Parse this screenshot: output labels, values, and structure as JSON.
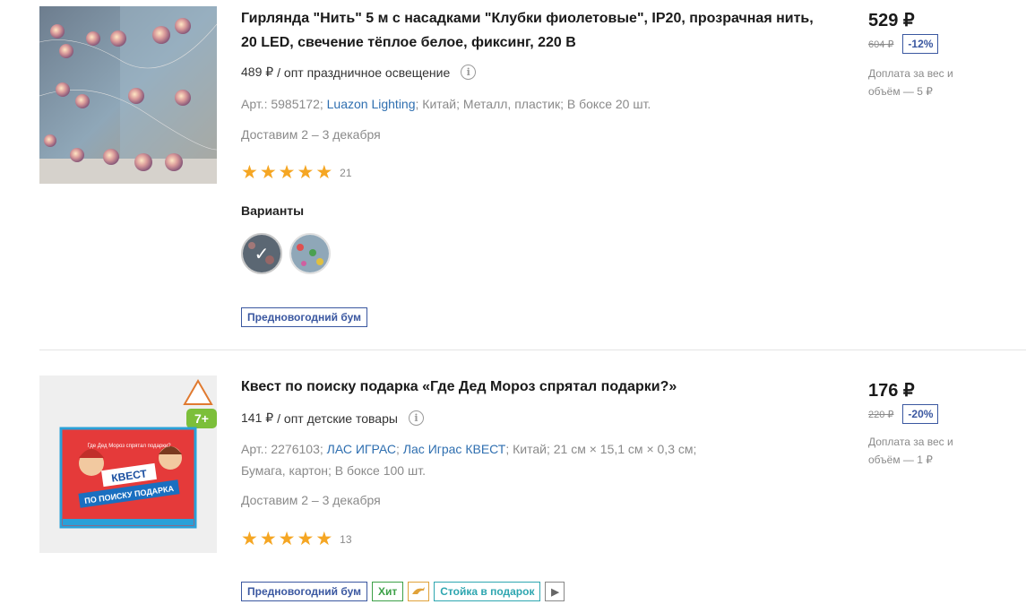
{
  "products": [
    {
      "title": "Гирлянда \"Нить\" 5 м с насадками \"Клубки фиолетовые\", IP20, прозрачная нить, 20 LED, свечение тёплое белое, фиксинг, 220 В",
      "opt_price": "489 ₽",
      "opt_label": "/ опт праздничное освещение",
      "art": "Арт.: 5985172;",
      "brand": "Luazon Lighting",
      "attrs": ";  Китай;  Металл, пластик;  В боксе 20 шт.",
      "delivery": "Доставим 2 – 3 декабря",
      "rating_count": "21",
      "variants_label": "Варианты",
      "badge": "Предновогодний бум",
      "price": "529 ₽",
      "old_price": "604 ₽",
      "discount": "-12%",
      "surcharge": "Доплата за вес и объём — 5 ₽"
    },
    {
      "title": "Квест по поиску подарка «Где Дед Мороз спрятал подарки?»",
      "opt_price": "141 ₽",
      "opt_label": "/ опт детские товары",
      "art": "Арт.: 2276103;",
      "brand1": "ЛАС ИГРАС",
      "brand2": "Лас Играс КВЕСТ",
      "attrs": ";  Китай;  21 см × 15,1 см × 0,3 см;  Бумага, картон;  В боксе 100 шт.",
      "delivery": "Доставим 2 – 3 декабря",
      "rating_count": "13",
      "badge1": "Предновогодний бум",
      "badge2": "Хит",
      "badge3": "Стойка в подарок",
      "price": "176 ₽",
      "old_price": "220 ₽",
      "discount": "-20%",
      "surcharge": "Доплата за вес и объём — 1 ₽",
      "image_text": {
        "age": "7+",
        "small": "Где Дед Мороз спрятал подарки?",
        "big1": "КВЕСТ",
        "big2": "ПО ПОИСКУ ПОДАРКА"
      }
    }
  ],
  "colors": {
    "link": "#2f6fb0",
    "star": "#f5a623",
    "badge_blue": "#3a57a0",
    "badge_green": "#3ca047",
    "badge_teal": "#2ea6b0"
  }
}
